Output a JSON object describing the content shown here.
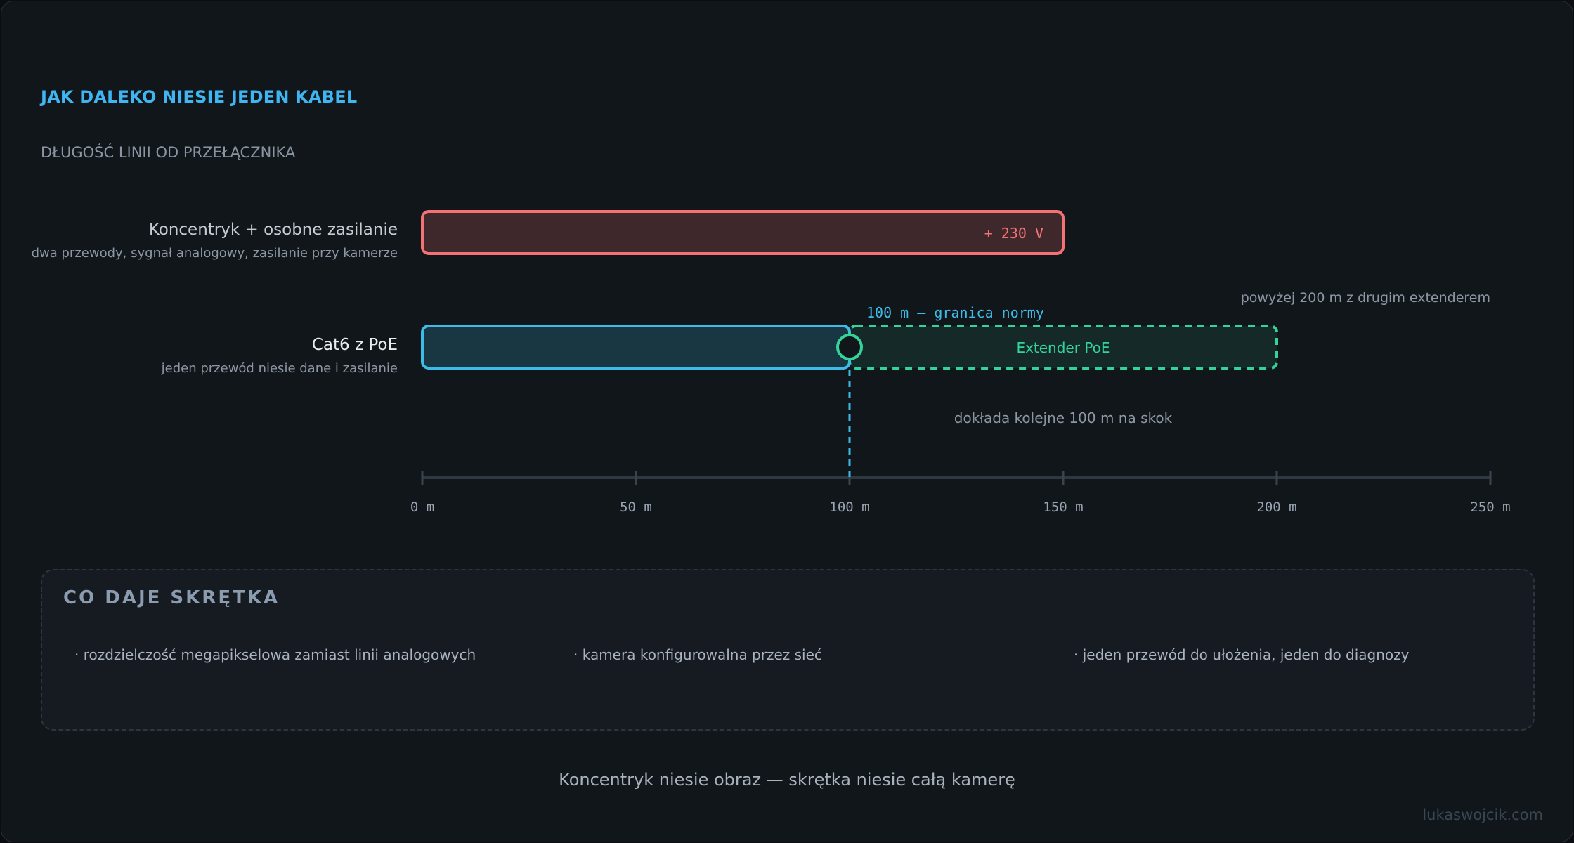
{
  "header": {
    "title": "JAK DALEKO NIESIE JEDEN KABEL",
    "subtitle": "DŁUGOŚĆ LINII OD PRZEŁĄCZNIKA"
  },
  "rows": [
    {
      "name": "Koncentryk + osobne zasilanie",
      "desc": "dwa przewody, sygnał analogowy, zasilanie przy kamerze"
    },
    {
      "name": "Cat6 z PoE",
      "desc": "jeden przewód niesie dane i zasilanie"
    }
  ],
  "chart_data": {
    "type": "bar",
    "orientation": "horizontal",
    "xlim": [
      0,
      250
    ],
    "unit": "m",
    "ticks": [
      0,
      50,
      100,
      150,
      200,
      250
    ],
    "tick_labels": [
      "0 m",
      "50 m",
      "100 m",
      "150 m",
      "200 m",
      "250 m"
    ],
    "bars": [
      {
        "category": "Koncentryk + osobne zasilanie",
        "start": 0,
        "end": 150,
        "style": "solid",
        "color": "#f47174",
        "label": "+ 230 V"
      },
      {
        "category": "Cat6 z PoE",
        "start": 0,
        "end": 100,
        "style": "solid",
        "color": "#3dbce8",
        "label": ""
      },
      {
        "category": "Cat6 z PoE",
        "start": 100,
        "end": 200,
        "style": "dashed",
        "color": "#34d399",
        "label": "Extender PoE"
      }
    ],
    "reference_line": {
      "x": 100,
      "label": "100 m — granica normy",
      "color": "#3dbce8"
    },
    "annotations": [
      "powyżej 200 m z drugim extenderem",
      "dokłada kolejne 100 m na skok"
    ]
  },
  "benefits": {
    "title": "CO DAJE SKRĘTKA",
    "items": [
      "· rozdzielczość megapikselowa zamiast linii analogowych",
      "· kamera konfigurowalna przez sieć",
      "· jeden przewód do ułożenia, jeden do diagnozy"
    ]
  },
  "footer": {
    "tagline": "Koncentryk niesie obraz — skrętka niesie całą kamerę",
    "credit": "lukaswojcik.com"
  }
}
